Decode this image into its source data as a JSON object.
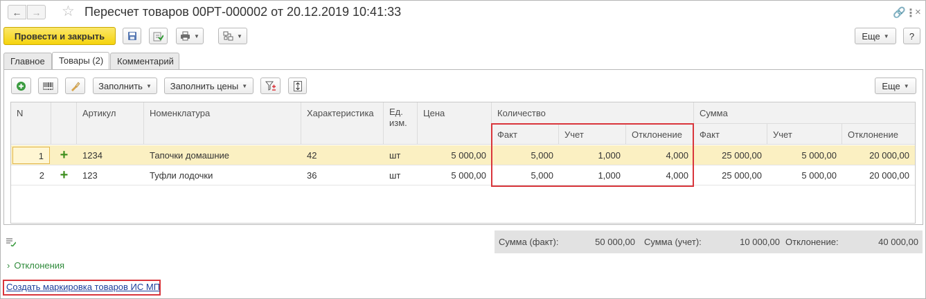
{
  "window": {
    "title": "Пересчет товаров 00РТ-000002 от 20.12.2019 10:41:33"
  },
  "toolbar": {
    "post_and_close": "Провести и закрыть",
    "more": "Еще",
    "help": "?"
  },
  "tabs": [
    {
      "label": "Главное"
    },
    {
      "label": "Товары (2)"
    },
    {
      "label": "Комментарий"
    }
  ],
  "goods_toolbar": {
    "fill": "Заполнить",
    "fill_prices": "Заполнить цены",
    "more": "Еще"
  },
  "table": {
    "headers": {
      "n": "N",
      "article": "Артикул",
      "item": "Номенклатура",
      "characteristic": "Характеристика",
      "unit": "Ед. изм.",
      "price": "Цена",
      "quantity": "Количество",
      "sum": "Сумма",
      "fact": "Факт",
      "account": "Учет",
      "deviation": "Отклонение"
    },
    "rows": [
      {
        "n": "1",
        "article": "1234",
        "item": "Тапочки домашние",
        "characteristic": "42",
        "unit": "шт",
        "price": "5 000,00",
        "qty_fact": "5,000",
        "qty_account": "1,000",
        "qty_dev": "4,000",
        "sum_fact": "25 000,00",
        "sum_account": "5 000,00",
        "sum_dev": "20 000,00"
      },
      {
        "n": "2",
        "article": "123",
        "item": "Туфли лодочки",
        "characteristic": "36",
        "unit": "шт",
        "price": "5 000,00",
        "qty_fact": "5,000",
        "qty_account": "1,000",
        "qty_dev": "4,000",
        "sum_fact": "25 000,00",
        "sum_account": "5 000,00",
        "sum_dev": "20 000,00"
      }
    ]
  },
  "totals": {
    "fact_label": "Сумма (факт):",
    "fact_value": "50 000,00",
    "account_label": "Сумма (учет):",
    "account_value": "10 000,00",
    "deviation_label": "Отклонение:",
    "deviation_value": "40 000,00"
  },
  "links": {
    "deviations": "Отклонения",
    "create_marking": "Создать маркировка товаров ИС МП"
  },
  "colors": {
    "primary_button": "#f5d30d",
    "selected_row": "#fbf0c2",
    "highlight_frame": "#d9353b",
    "link_green": "#2e8a3a",
    "link_blue": "#1b3f9b"
  },
  "icons": [
    "back-arrow-icon",
    "forward-arrow-icon",
    "star-icon",
    "link-icon",
    "more-vertical-icon",
    "close-icon",
    "save-icon",
    "post-icon",
    "print-icon",
    "structure-icon",
    "add-icon",
    "barcode-icon",
    "brush-icon",
    "filter-icon",
    "expand-rows-icon",
    "plus-icon",
    "edit-list-icon",
    "chevron-right-icon"
  ]
}
